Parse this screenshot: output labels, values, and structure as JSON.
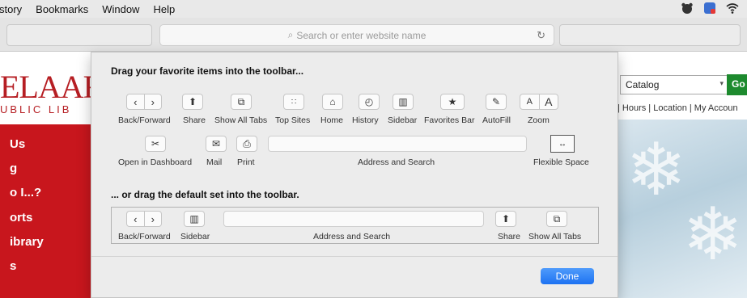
{
  "menubar": {
    "items": [
      "story",
      "Bookmarks",
      "Window",
      "Help"
    ]
  },
  "browser": {
    "address_placeholder": "Search or enter website name"
  },
  "website": {
    "logo": "ELAAR",
    "logo_sub": "UBLIC LIB",
    "nav": [
      "Us",
      "g",
      "o I...?",
      "orts",
      "ibrary",
      "s"
    ],
    "catalog_select": "Catalog",
    "go_label": "Go",
    "links": "| Hours | Location | My Accoun"
  },
  "customize": {
    "heading_favorites": "Drag your favorite items into the toolbar...",
    "heading_default": "... or drag the default set into the toolbar.",
    "items": {
      "back_forward": "Back/Forward",
      "share": "Share",
      "show_all_tabs": "Show All Tabs",
      "top_sites": "Top Sites",
      "home": "Home",
      "history": "History",
      "sidebar": "Sidebar",
      "favorites_bar": "Favorites Bar",
      "autofill": "AutoFill",
      "zoom": "Zoom",
      "open_in_dashboard": "Open in Dashboard",
      "mail": "Mail",
      "print": "Print",
      "address_and_search": "Address and Search",
      "flexible_space": "Flexible Space"
    },
    "zoom_small": "A",
    "zoom_large": "A",
    "default_set": {
      "back_forward": "Back/Forward",
      "sidebar": "Sidebar",
      "address_and_search": "Address and Search",
      "share": "Share",
      "show_all_tabs": "Show All Tabs"
    },
    "done_label": "Done"
  },
  "colors": {
    "brand_red": "#c8161d",
    "done_blue": "#1d72f2",
    "go_green": "#1d8a2e"
  }
}
